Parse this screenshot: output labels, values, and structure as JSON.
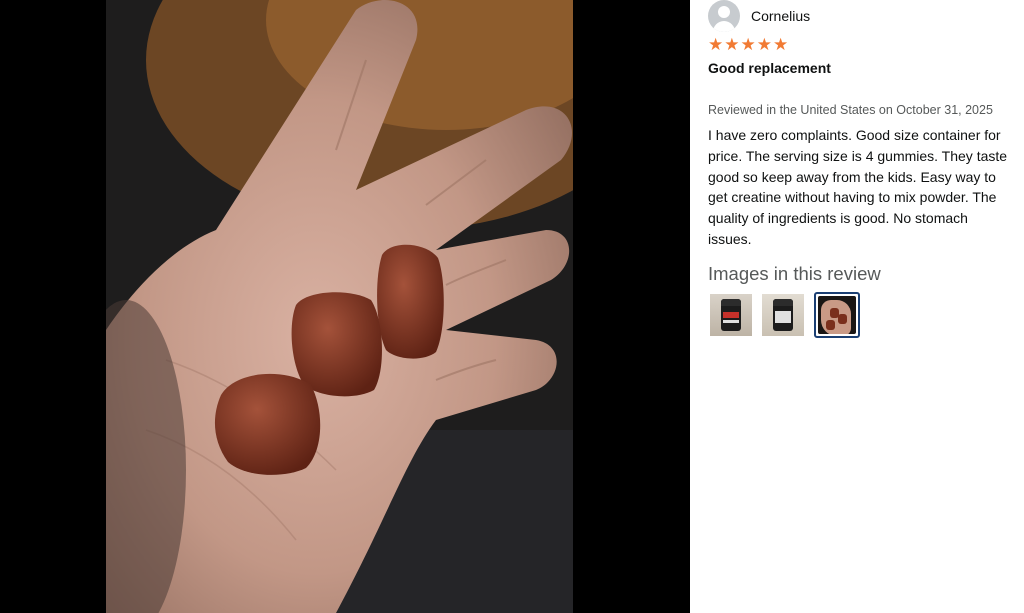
{
  "review": {
    "author": "Cornelius",
    "rating": 5,
    "rating_max": 5,
    "star_color": "#f17a33",
    "title": "Good replacement",
    "meta": "Reviewed in the United States on October 31, 2025",
    "body": "I have zero complaints. Good size container for price. The serving size is 4 gummies. They taste good so keep away from the kids. Easy way to get creatine without having to mix powder. The quality of ingredients is good. No stomach issues."
  },
  "images": {
    "heading": "Images in this review",
    "selected_index": 2,
    "thumbnails": [
      {
        "subject": "product-jar-front"
      },
      {
        "subject": "product-jar-back"
      },
      {
        "subject": "gummies-in-hand"
      }
    ]
  },
  "colors": {
    "viewer_background": "#000000",
    "selected_border": "#1b3f73",
    "secondary_text": "#565959"
  }
}
